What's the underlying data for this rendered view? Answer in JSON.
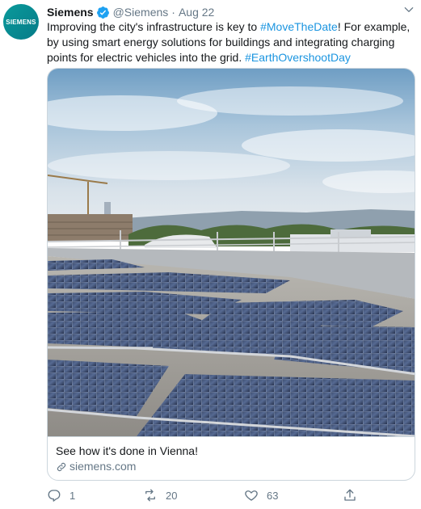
{
  "tweet": {
    "avatar_text": "SIEMENS",
    "author_name": "Siemens",
    "handle": "@Siemens",
    "separator": "·",
    "date": "Aug 22",
    "text_parts": {
      "p1": "Improving the city's infrastructure is key to ",
      "tag1": "#MoveTheDate",
      "p2": "! For example, by using smart energy solutions for buildings and integrating charging points for electric vehicles into the grid. ",
      "tag2": "#EarthOvershootDay"
    }
  },
  "card": {
    "title": "See how it's done in Vienna!",
    "domain": "siemens.com"
  },
  "actions": {
    "reply_count": "1",
    "retweet_count": "20",
    "like_count": "63"
  },
  "colors": {
    "brand_avatar": "#0a9a9b",
    "link": "#1b95e0",
    "muted": "#657786",
    "verified": "#1da1f2"
  },
  "icons": [
    "verified-badge-icon",
    "caret-down-icon",
    "link-icon",
    "reply-icon",
    "retweet-icon",
    "like-icon",
    "share-icon"
  ]
}
